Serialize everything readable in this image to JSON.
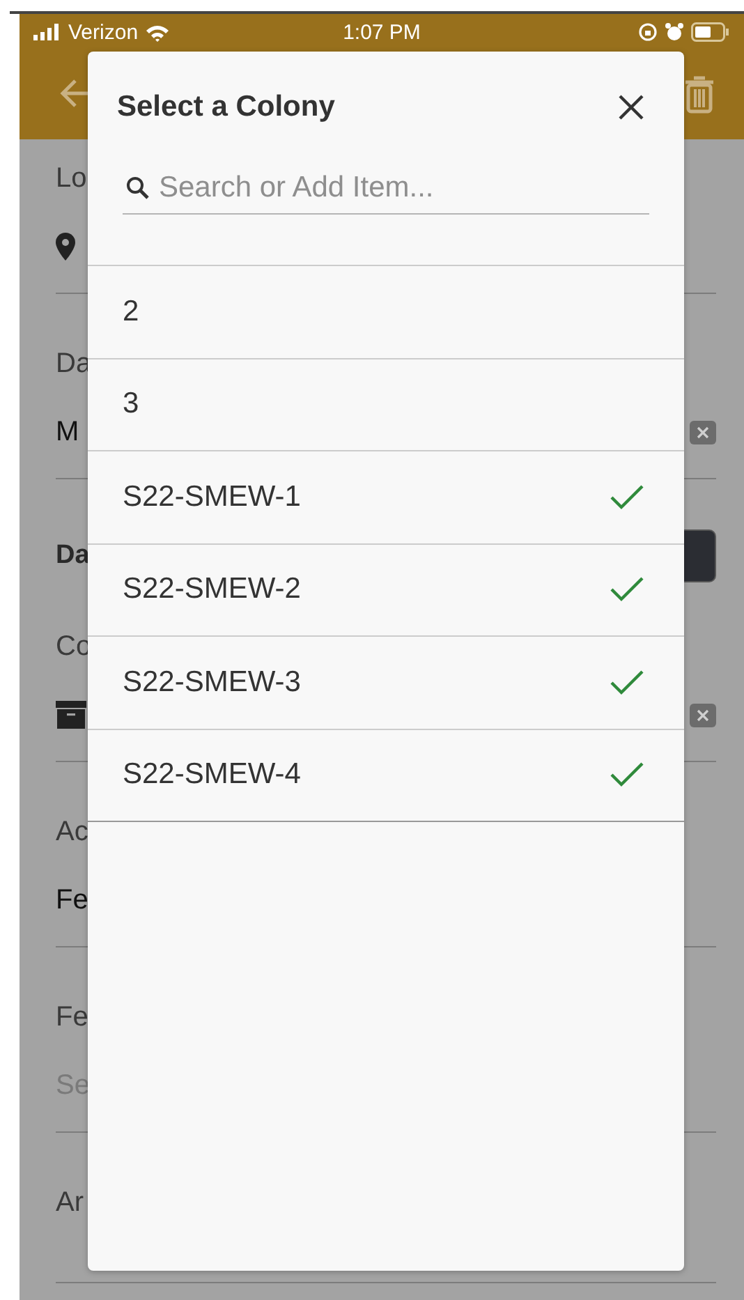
{
  "status_bar": {
    "carrier": "Verizon",
    "time": "1:07 PM"
  },
  "background_form": [
    {
      "label": "Lo",
      "kind": "pin",
      "clearable": false
    },
    {
      "label": "Da",
      "kind": "text",
      "value": "M",
      "clearable": true
    },
    {
      "label": "Da",
      "kind": "section"
    },
    {
      "label": "Co",
      "kind": "archive",
      "clearable": true
    },
    {
      "label": "Ac",
      "kind": "text",
      "value": "Fe",
      "clearable": false
    },
    {
      "label": "Fe",
      "kind": "input",
      "placeholder": "Se",
      "clearable": false
    },
    {
      "label": "Ar",
      "kind": "empty"
    }
  ],
  "dialog": {
    "title": "Select a Colony",
    "search": {
      "placeholder": "Search or Add Item..."
    },
    "items": [
      {
        "label": "2",
        "checked": false
      },
      {
        "label": "3",
        "checked": false
      },
      {
        "label": "S22-SMEW-1",
        "checked": true
      },
      {
        "label": "S22-SMEW-2",
        "checked": true
      },
      {
        "label": "S22-SMEW-3",
        "checked": true
      },
      {
        "label": "S22-SMEW-4",
        "checked": true
      }
    ]
  }
}
